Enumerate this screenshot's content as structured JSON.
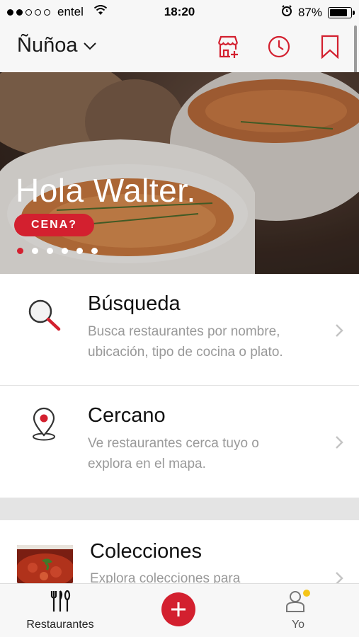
{
  "status_bar": {
    "carrier": "entel",
    "time": "18:20",
    "battery": "87%",
    "battery_level": 0.87,
    "signal_bars_filled": 2,
    "signal_bars_total": 5
  },
  "nav": {
    "location": "Ñuñoa"
  },
  "hero": {
    "greeting": "Hola Walter.",
    "pill": "CENA?",
    "pages": 6,
    "active_page": 0
  },
  "menu": {
    "search": {
      "title": "Búsqueda",
      "desc_line1": "Busca restaurantes por nombre,",
      "desc_line2": "ubicación, tipo de cocina o plato."
    },
    "nearby": {
      "title": "Cercano",
      "desc_line1": "Ve restaurantes cerca tuyo o",
      "desc_line2": "explora en el mapa."
    },
    "collections": {
      "title": "Colecciones",
      "desc_line1": "Explora colecciones para"
    }
  },
  "tabs": {
    "restaurants": "Restaurantes",
    "me": "Yo"
  },
  "colors": {
    "accent": "#d3202f",
    "notification": "#f5c518"
  }
}
